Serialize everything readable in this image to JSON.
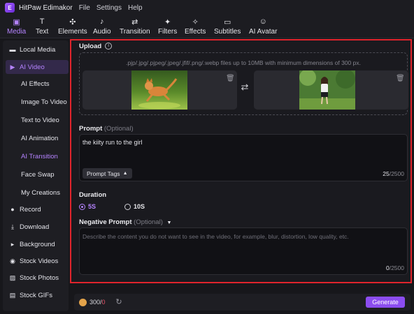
{
  "app": {
    "title": "HitPaw Edimakor",
    "logo_text": "E"
  },
  "menu": [
    "File",
    "Settings",
    "Help"
  ],
  "toolbar": [
    {
      "label": "Media",
      "icon": "media-icon",
      "glyph": "▣",
      "active": true
    },
    {
      "label": "Text",
      "icon": "text-icon",
      "glyph": "T",
      "active": false
    },
    {
      "label": "Elements",
      "icon": "elements-icon",
      "glyph": "✣",
      "active": false
    },
    {
      "label": "Audio",
      "icon": "audio-icon",
      "glyph": "♪",
      "active": false
    },
    {
      "label": "Transition",
      "icon": "transition-icon",
      "glyph": "⇄",
      "active": false
    },
    {
      "label": "Filters",
      "icon": "filters-icon",
      "glyph": "✦",
      "active": false
    },
    {
      "label": "Effects",
      "icon": "effects-icon",
      "glyph": "✧",
      "active": false
    },
    {
      "label": "Subtitles",
      "icon": "subtitles-icon",
      "glyph": "▭",
      "active": false
    },
    {
      "label": "AI Avatar",
      "icon": "ai-avatar-icon",
      "glyph": "☺",
      "active": false
    }
  ],
  "sidebar": [
    {
      "label": "Local Media",
      "icon": "folder-icon",
      "glyph": "▬",
      "sub": false,
      "active": false
    },
    {
      "label": "AI Video",
      "icon": "ai-video-icon",
      "glyph": "▶",
      "sub": false,
      "active": true
    },
    {
      "label": "AI Effects",
      "sub": true,
      "active": false
    },
    {
      "label": "Image To Video",
      "sub": true,
      "active": false
    },
    {
      "label": "Text to Video",
      "sub": true,
      "active": false
    },
    {
      "label": "AI Animation",
      "sub": true,
      "active": false
    },
    {
      "label": "AI Transition",
      "sub": true,
      "active": true
    },
    {
      "label": "Face Swap",
      "sub": true,
      "active": false
    },
    {
      "label": "My Creations",
      "sub": true,
      "active": false
    },
    {
      "label": "Record",
      "icon": "record-icon",
      "glyph": "●",
      "sub": false,
      "active": false
    },
    {
      "label": "Download",
      "icon": "download-icon",
      "glyph": "⤓",
      "sub": false,
      "active": false
    },
    {
      "label": "Background",
      "icon": "background-icon",
      "glyph": "▸",
      "sub": false,
      "active": false
    },
    {
      "label": "Stock Videos",
      "icon": "stock-videos-icon",
      "glyph": "◉",
      "sub": false,
      "active": false
    },
    {
      "label": "Stock Photos",
      "icon": "stock-photos-icon",
      "glyph": "▨",
      "sub": false,
      "active": false
    },
    {
      "label": "Stock GIFs",
      "icon": "stock-gifs-icon",
      "glyph": "▤",
      "sub": false,
      "active": false
    }
  ],
  "upload": {
    "label": "Upload",
    "hint": ".pjp/.jpg/.pjpeg/.jpeg/.jfif/.png/.webp files up to 10MB with minimum dimensions of 300 px."
  },
  "prompt": {
    "label": "Prompt",
    "optional": "(Optional)",
    "value": "the kiity run to the girl",
    "tags_button": "Prompt Tags",
    "count": "25",
    "max": "/2500"
  },
  "duration": {
    "label": "Duration",
    "options": [
      {
        "label": "5S",
        "checked": true
      },
      {
        "label": "10S",
        "checked": false
      }
    ]
  },
  "negative": {
    "label": "Negative Prompt",
    "optional": "(Optional)",
    "placeholder": "Describe the content you do not want to see in the video, for example, blur, distortion, low quality, etc.",
    "count": "0",
    "max": "/2500"
  },
  "credits": {
    "have": "300",
    "sep": "/",
    "need": "0"
  },
  "generate_label": "Generate",
  "colors": {
    "accent": "#8c4df0",
    "accent_text": "#b583ff",
    "highlight_border": "#e0242c"
  }
}
